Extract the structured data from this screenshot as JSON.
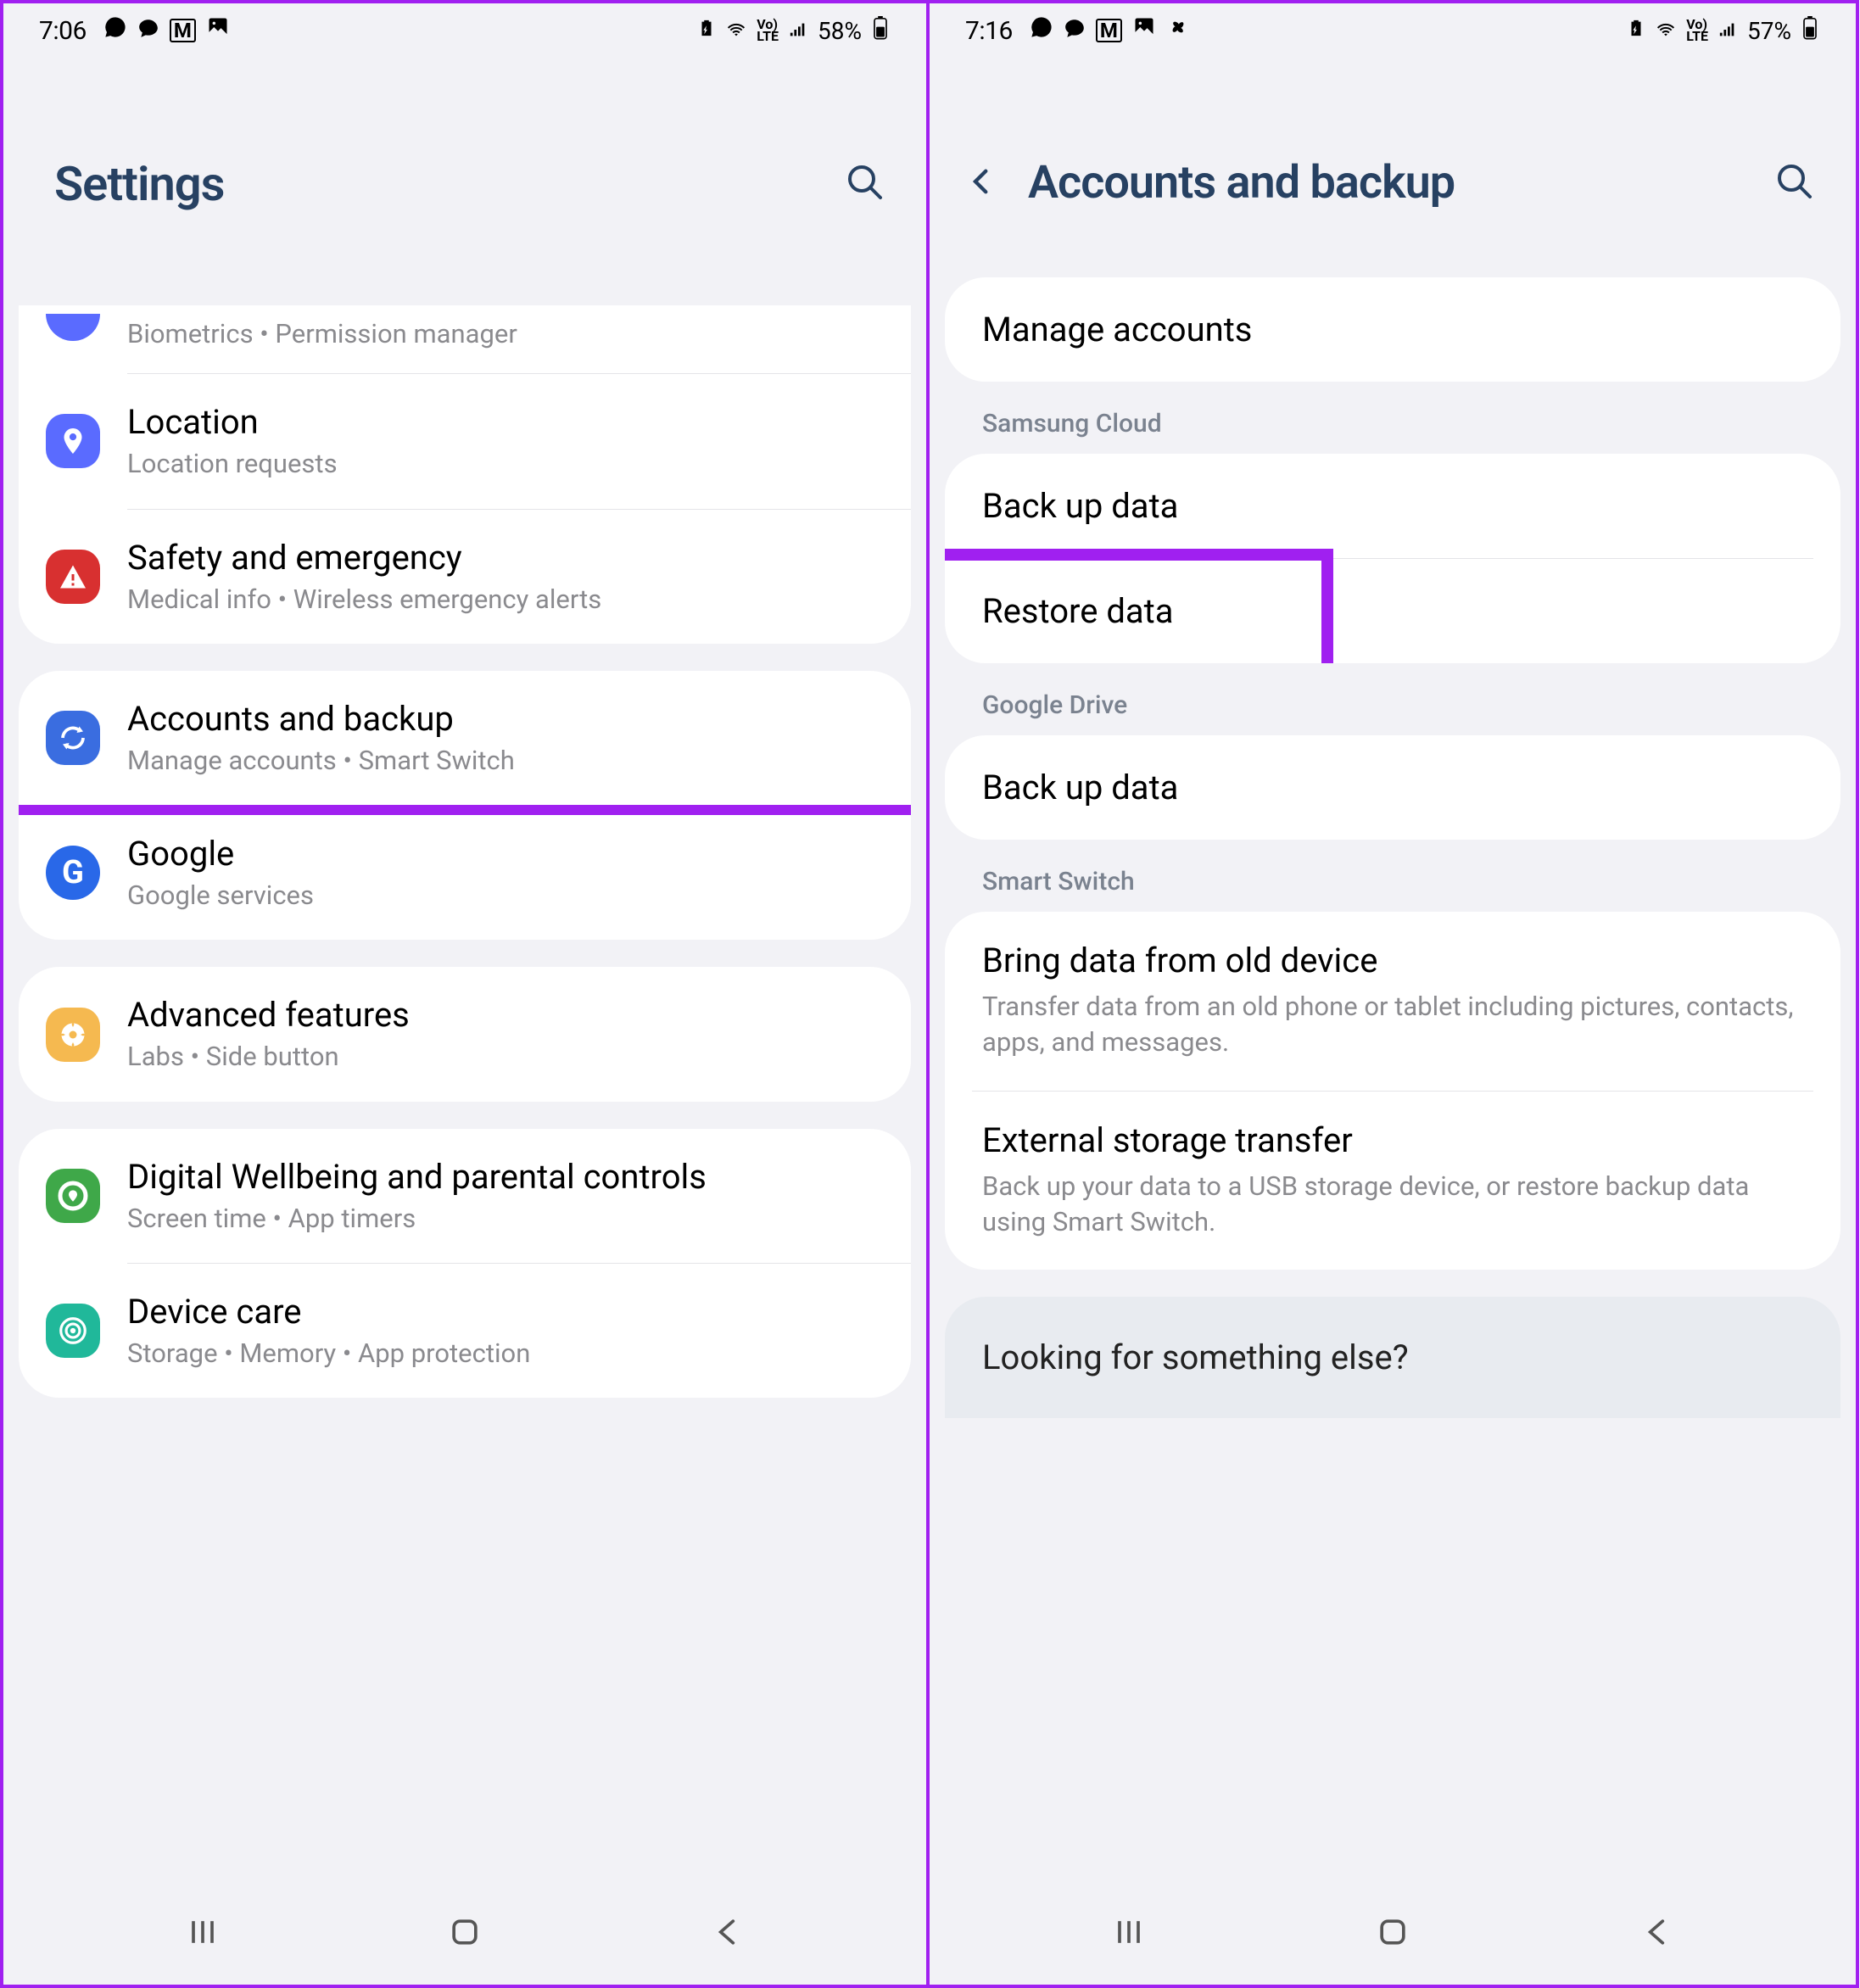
{
  "left": {
    "status": {
      "time": "7:06",
      "battery_pct": "58%"
    },
    "header": {
      "title": "Settings"
    },
    "items": [
      {
        "subtitle": "Biometrics  •  Permission manager"
      },
      {
        "title": "Location",
        "subtitle": "Location requests"
      },
      {
        "title": "Safety and emergency",
        "subtitle": "Medical info  •  Wireless emergency alerts"
      },
      {
        "title": "Accounts and backup",
        "subtitle": "Manage accounts  •  Smart Switch"
      },
      {
        "title": "Google",
        "subtitle": "Google services"
      },
      {
        "title": "Advanced features",
        "subtitle": "Labs  •  Side button"
      },
      {
        "title": "Digital Wellbeing and parental controls",
        "subtitle": "Screen time  •  App timers"
      },
      {
        "title": "Device care",
        "subtitle": "Storage  •  Memory  •  App protection"
      }
    ]
  },
  "right": {
    "status": {
      "time": "7:16",
      "battery_pct": "57%"
    },
    "header": {
      "title": "Accounts and backup"
    },
    "manage": "Manage accounts",
    "sections": {
      "samsung_cloud": {
        "label": "Samsung Cloud",
        "backup": "Back up data",
        "restore": "Restore data"
      },
      "google_drive": {
        "label": "Google Drive",
        "backup": "Back up data"
      },
      "smart_switch": {
        "label": "Smart Switch",
        "bring": {
          "title": "Bring data from old device",
          "desc": "Transfer data from an old phone or tablet including pictures, contacts, apps, and messages."
        },
        "external": {
          "title": "External storage transfer",
          "desc": "Back up your data to a USB storage device, or restore backup data using Smart Switch."
        }
      }
    },
    "looking": "Looking for something else?"
  }
}
